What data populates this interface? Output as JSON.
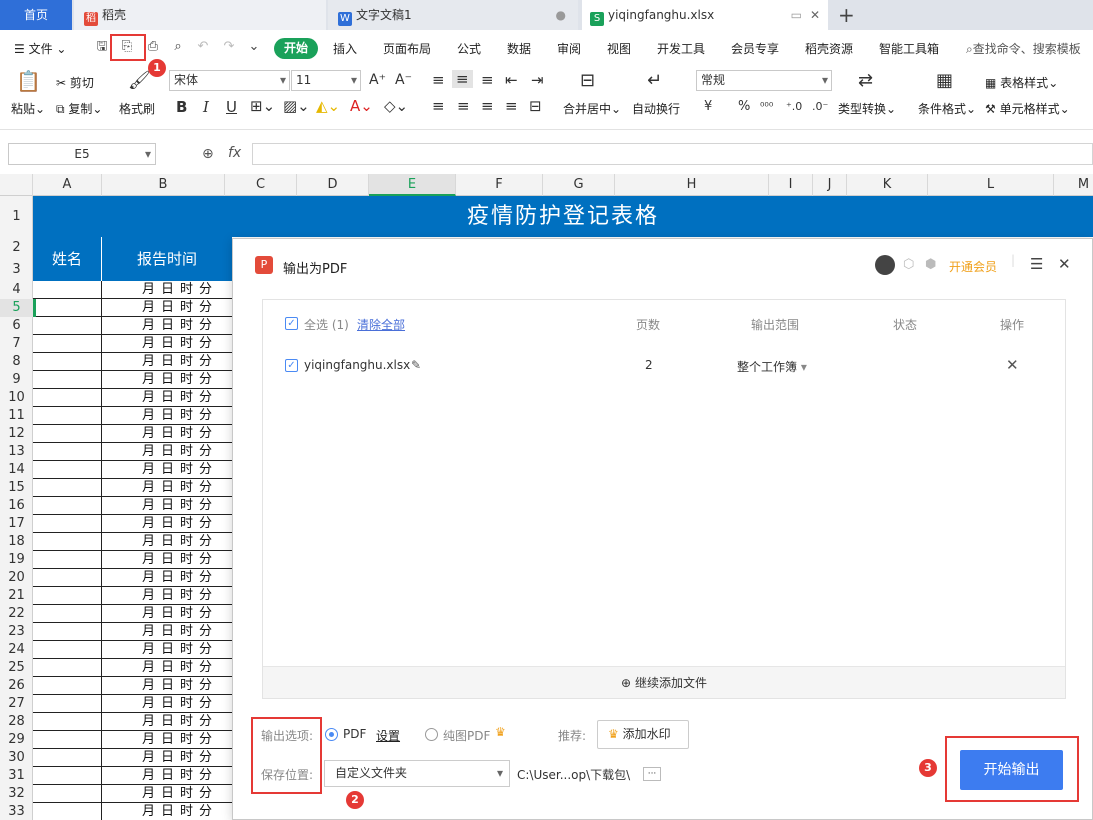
{
  "tabs": {
    "home": "首页",
    "daoke": "稻壳",
    "doc": "文字文稿1",
    "xlsx": "yiqingfanghu.xlsx"
  },
  "menu": {
    "file": "文件",
    "start": "开始",
    "items": [
      "插入",
      "页面布局",
      "公式",
      "数据",
      "审阅",
      "视图",
      "开发工具",
      "会员专享",
      "稻壳资源",
      "智能工具箱"
    ],
    "search": "查找命令、搜索模板"
  },
  "ribbon": {
    "paste": "粘贴",
    "cut": "剪切",
    "copy": "复制",
    "format_painter": "格式刷",
    "font_name": "宋体",
    "font_size": "11",
    "bold": "B",
    "italic": "I",
    "underline": "U",
    "merge_center": "合并居中",
    "wrap_text": "自动换行",
    "number_format": "常规",
    "type_convert": "类型转换",
    "conditional_format": "条件格式",
    "table_style": "表格样式",
    "cell_style": "单元格样式",
    "currency": "¥",
    "percent": "%"
  },
  "formula_bar": {
    "cell_ref": "E5",
    "fx": "fx"
  },
  "sheet": {
    "columns": [
      "A",
      "B",
      "C",
      "D",
      "E",
      "F",
      "G",
      "H",
      "I",
      "J",
      "K",
      "L",
      "M"
    ],
    "rows": [
      "1",
      "2",
      "3",
      "4",
      "5",
      "6",
      "7",
      "8",
      "9",
      "10",
      "11",
      "12",
      "13",
      "14",
      "15",
      "16",
      "17",
      "18",
      "19",
      "20",
      "21",
      "22",
      "23",
      "24",
      "25",
      "26",
      "27",
      "28",
      "29",
      "30",
      "31",
      "32",
      "33"
    ],
    "title": "疫情防护登记表格",
    "header_name": "姓名",
    "header_time": "报告时间",
    "time_placeholder": "月日时分"
  },
  "dialog": {
    "title": "输出为PDF",
    "vip": "开通会员",
    "select_all": "全选 (1)",
    "clear_all": "清除全部",
    "col_pages": "页数",
    "col_range": "输出范围",
    "col_status": "状态",
    "col_action": "操作",
    "file_name": "yiqingfanghu.xlsx",
    "file_pages": "2",
    "file_range": "整个工作簿",
    "add_files": "继续添加文件",
    "output_options_label": "输出选项:",
    "opt_pdf": "PDF",
    "opt_settings": "设置",
    "opt_image_pdf": "纯图PDF",
    "recommend_label": "推荐:",
    "watermark": "添加水印",
    "save_location_label": "保存位置:",
    "save_location_value": "自定义文件夹",
    "save_path": "C:\\User...op\\下载包\\",
    "more": "···",
    "start_output": "开始输出"
  },
  "annotations": [
    "1",
    "2",
    "3"
  ],
  "colors": {
    "accent": "#0070c0",
    "button": "#3d7cf0",
    "highlight": "#e53935",
    "start_tab": "#1aa15a"
  }
}
